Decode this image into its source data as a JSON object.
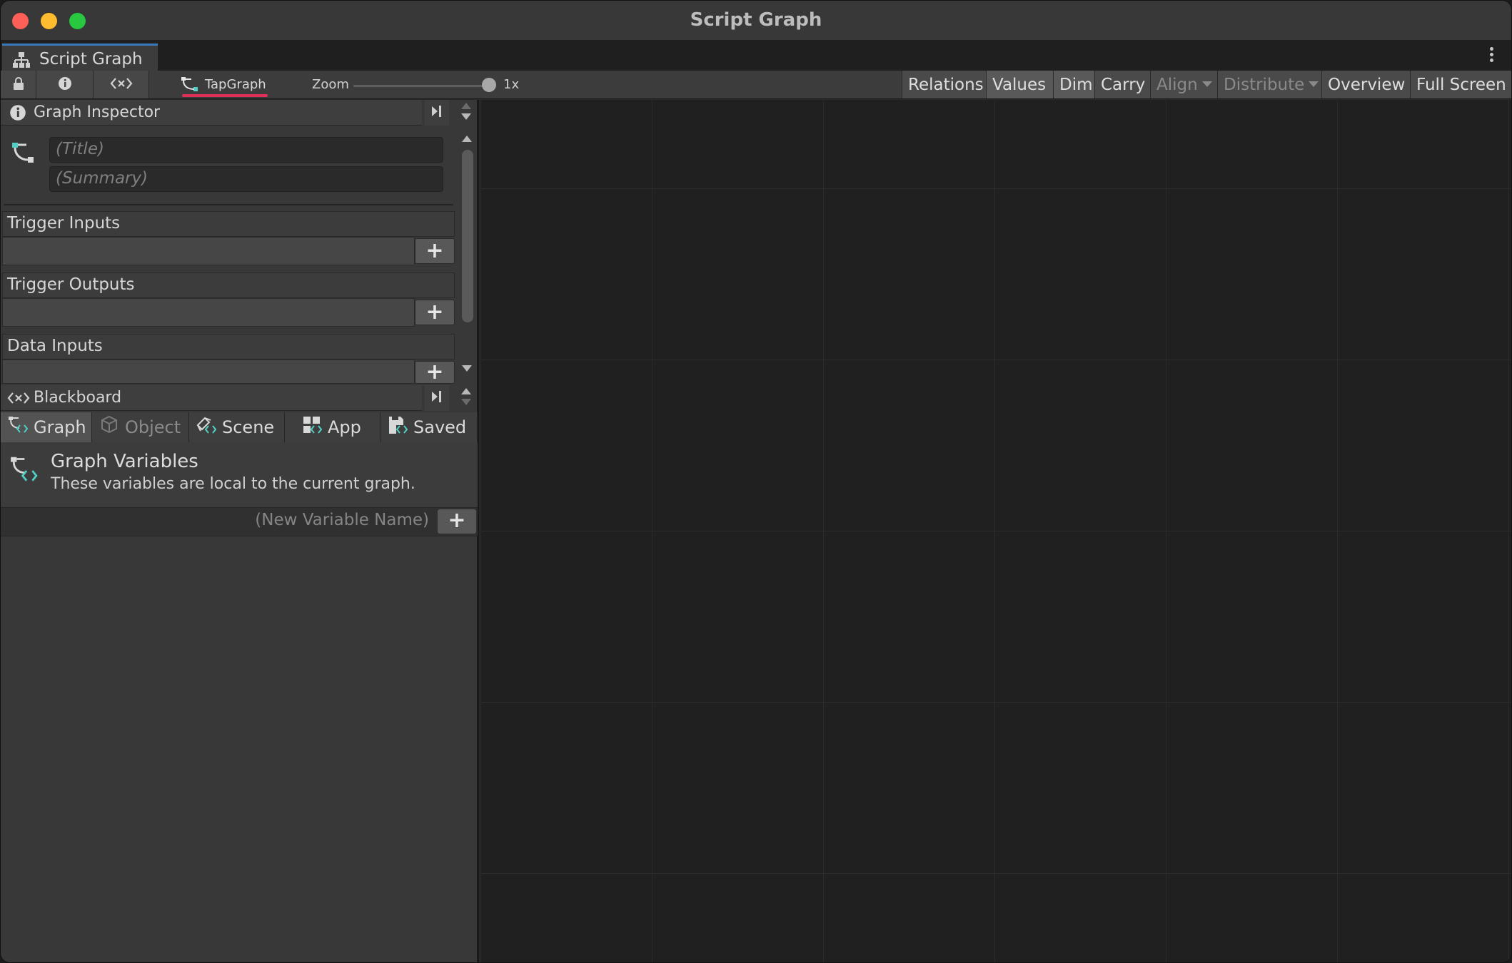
{
  "window": {
    "title": "Script Graph"
  },
  "editor_tab": {
    "label": "Script Graph"
  },
  "toolbar": {
    "graph_name": "TapGraph",
    "zoom_label": "Zoom",
    "zoom_value": "1x",
    "zoom_level": 1.0,
    "buttons": [
      {
        "label": "Relations",
        "state": "off"
      },
      {
        "label": "Values",
        "state": "on"
      },
      {
        "label": "Dim",
        "state": "on"
      },
      {
        "label": "Carry",
        "state": "off"
      },
      {
        "label": "Align",
        "state": "disabled"
      },
      {
        "label": "Distribute",
        "state": "disabled"
      },
      {
        "label": "Overview",
        "state": "off"
      },
      {
        "label": "Full Screen",
        "state": "off"
      }
    ]
  },
  "inspector": {
    "title": "Graph Inspector",
    "title_placeholder": "(Title)",
    "summary_placeholder": "(Summary)",
    "sections": [
      {
        "label": "Trigger Inputs"
      },
      {
        "label": "Trigger Outputs"
      },
      {
        "label": "Data Inputs"
      }
    ]
  },
  "blackboard": {
    "title": "Blackboard",
    "tabs": [
      {
        "label": "Graph",
        "active": true,
        "enabled": true
      },
      {
        "label": "Object",
        "active": false,
        "enabled": false
      },
      {
        "label": "Scene",
        "active": false,
        "enabled": true
      },
      {
        "label": "App",
        "active": false,
        "enabled": true
      },
      {
        "label": "Saved",
        "active": false,
        "enabled": true
      }
    ],
    "variables_title": "Graph Variables",
    "variables_desc": "These variables are local to the current graph.",
    "new_variable_placeholder": "(New Variable Name)"
  },
  "colors": {
    "accent_graph": "#4fd1c5",
    "tab_highlight": "#3a79bb",
    "graph_underline": "#e0305a",
    "close": "#fe5f57",
    "minimize": "#febc2e",
    "maximize": "#28c840"
  },
  "icons": {
    "lock": "lock-icon",
    "info": "info-icon",
    "variables": "variables-icon",
    "graph": "graph-icon",
    "hierarchy": "hierarchy-icon",
    "add": "plus-icon"
  }
}
